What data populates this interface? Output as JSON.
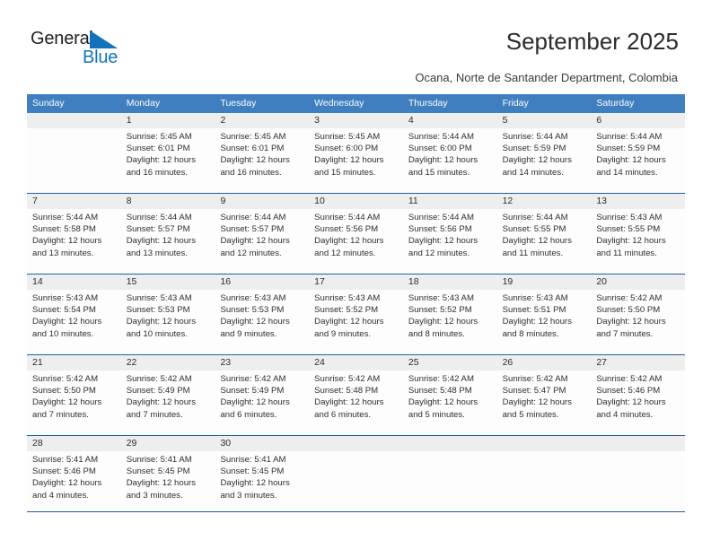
{
  "brand": {
    "name_part1": "General",
    "name_part2": "Blue",
    "triangle_icon": "triangle-icon",
    "accent_color": "#1273ba"
  },
  "header": {
    "title": "September 2025",
    "subtitle": "Ocana, Norte de Santander Department, Colombia"
  },
  "theme": {
    "header_blue": "#3f7fbf",
    "rule_blue": "#1f5fa6",
    "datestrip_gray": "#eeeeee"
  },
  "calendar": {
    "day_names": [
      "Sunday",
      "Monday",
      "Tuesday",
      "Wednesday",
      "Thursday",
      "Friday",
      "Saturday"
    ],
    "weeks": [
      [
        {
          "date": "",
          "empty": true,
          "sunrise": "",
          "sunset": "",
          "daylight": ""
        },
        {
          "date": "1",
          "sunrise": "Sunrise: 5:45 AM",
          "sunset": "Sunset: 6:01 PM",
          "daylight": "Daylight: 12 hours and 16 minutes."
        },
        {
          "date": "2",
          "sunrise": "Sunrise: 5:45 AM",
          "sunset": "Sunset: 6:01 PM",
          "daylight": "Daylight: 12 hours and 16 minutes."
        },
        {
          "date": "3",
          "sunrise": "Sunrise: 5:45 AM",
          "sunset": "Sunset: 6:00 PM",
          "daylight": "Daylight: 12 hours and 15 minutes."
        },
        {
          "date": "4",
          "sunrise": "Sunrise: 5:44 AM",
          "sunset": "Sunset: 6:00 PM",
          "daylight": "Daylight: 12 hours and 15 minutes."
        },
        {
          "date": "5",
          "sunrise": "Sunrise: 5:44 AM",
          "sunset": "Sunset: 5:59 PM",
          "daylight": "Daylight: 12 hours and 14 minutes."
        },
        {
          "date": "6",
          "sunrise": "Sunrise: 5:44 AM",
          "sunset": "Sunset: 5:59 PM",
          "daylight": "Daylight: 12 hours and 14 minutes."
        }
      ],
      [
        {
          "date": "7",
          "sunrise": "Sunrise: 5:44 AM",
          "sunset": "Sunset: 5:58 PM",
          "daylight": "Daylight: 12 hours and 13 minutes."
        },
        {
          "date": "8",
          "sunrise": "Sunrise: 5:44 AM",
          "sunset": "Sunset: 5:57 PM",
          "daylight": "Daylight: 12 hours and 13 minutes."
        },
        {
          "date": "9",
          "sunrise": "Sunrise: 5:44 AM",
          "sunset": "Sunset: 5:57 PM",
          "daylight": "Daylight: 12 hours and 12 minutes."
        },
        {
          "date": "10",
          "sunrise": "Sunrise: 5:44 AM",
          "sunset": "Sunset: 5:56 PM",
          "daylight": "Daylight: 12 hours and 12 minutes."
        },
        {
          "date": "11",
          "sunrise": "Sunrise: 5:44 AM",
          "sunset": "Sunset: 5:56 PM",
          "daylight": "Daylight: 12 hours and 12 minutes."
        },
        {
          "date": "12",
          "sunrise": "Sunrise: 5:44 AM",
          "sunset": "Sunset: 5:55 PM",
          "daylight": "Daylight: 12 hours and 11 minutes."
        },
        {
          "date": "13",
          "sunrise": "Sunrise: 5:43 AM",
          "sunset": "Sunset: 5:55 PM",
          "daylight": "Daylight: 12 hours and 11 minutes."
        }
      ],
      [
        {
          "date": "14",
          "sunrise": "Sunrise: 5:43 AM",
          "sunset": "Sunset: 5:54 PM",
          "daylight": "Daylight: 12 hours and 10 minutes."
        },
        {
          "date": "15",
          "sunrise": "Sunrise: 5:43 AM",
          "sunset": "Sunset: 5:53 PM",
          "daylight": "Daylight: 12 hours and 10 minutes."
        },
        {
          "date": "16",
          "sunrise": "Sunrise: 5:43 AM",
          "sunset": "Sunset: 5:53 PM",
          "daylight": "Daylight: 12 hours and 9 minutes."
        },
        {
          "date": "17",
          "sunrise": "Sunrise: 5:43 AM",
          "sunset": "Sunset: 5:52 PM",
          "daylight": "Daylight: 12 hours and 9 minutes."
        },
        {
          "date": "18",
          "sunrise": "Sunrise: 5:43 AM",
          "sunset": "Sunset: 5:52 PM",
          "daylight": "Daylight: 12 hours and 8 minutes."
        },
        {
          "date": "19",
          "sunrise": "Sunrise: 5:43 AM",
          "sunset": "Sunset: 5:51 PM",
          "daylight": "Daylight: 12 hours and 8 minutes."
        },
        {
          "date": "20",
          "sunrise": "Sunrise: 5:42 AM",
          "sunset": "Sunset: 5:50 PM",
          "daylight": "Daylight: 12 hours and 7 minutes."
        }
      ],
      [
        {
          "date": "21",
          "sunrise": "Sunrise: 5:42 AM",
          "sunset": "Sunset: 5:50 PM",
          "daylight": "Daylight: 12 hours and 7 minutes."
        },
        {
          "date": "22",
          "sunrise": "Sunrise: 5:42 AM",
          "sunset": "Sunset: 5:49 PM",
          "daylight": "Daylight: 12 hours and 7 minutes."
        },
        {
          "date": "23",
          "sunrise": "Sunrise: 5:42 AM",
          "sunset": "Sunset: 5:49 PM",
          "daylight": "Daylight: 12 hours and 6 minutes."
        },
        {
          "date": "24",
          "sunrise": "Sunrise: 5:42 AM",
          "sunset": "Sunset: 5:48 PM",
          "daylight": "Daylight: 12 hours and 6 minutes."
        },
        {
          "date": "25",
          "sunrise": "Sunrise: 5:42 AM",
          "sunset": "Sunset: 5:48 PM",
          "daylight": "Daylight: 12 hours and 5 minutes."
        },
        {
          "date": "26",
          "sunrise": "Sunrise: 5:42 AM",
          "sunset": "Sunset: 5:47 PM",
          "daylight": "Daylight: 12 hours and 5 minutes."
        },
        {
          "date": "27",
          "sunrise": "Sunrise: 5:42 AM",
          "sunset": "Sunset: 5:46 PM",
          "daylight": "Daylight: 12 hours and 4 minutes."
        }
      ],
      [
        {
          "date": "28",
          "sunrise": "Sunrise: 5:41 AM",
          "sunset": "Sunset: 5:46 PM",
          "daylight": "Daylight: 12 hours and 4 minutes."
        },
        {
          "date": "29",
          "sunrise": "Sunrise: 5:41 AM",
          "sunset": "Sunset: 5:45 PM",
          "daylight": "Daylight: 12 hours and 3 minutes."
        },
        {
          "date": "30",
          "sunrise": "Sunrise: 5:41 AM",
          "sunset": "Sunset: 5:45 PM",
          "daylight": "Daylight: 12 hours and 3 minutes."
        },
        {
          "date": "",
          "empty": true,
          "sunrise": "",
          "sunset": "",
          "daylight": ""
        },
        {
          "date": "",
          "empty": true,
          "sunrise": "",
          "sunset": "",
          "daylight": ""
        },
        {
          "date": "",
          "empty": true,
          "sunrise": "",
          "sunset": "",
          "daylight": ""
        },
        {
          "date": "",
          "empty": true,
          "sunrise": "",
          "sunset": "",
          "daylight": ""
        }
      ]
    ]
  }
}
